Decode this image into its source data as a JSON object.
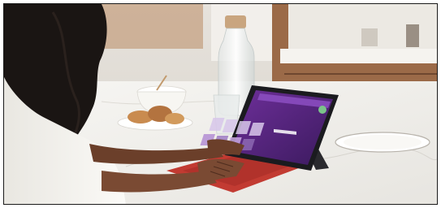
{
  "scene": {
    "description_icon": "photo-of-person-typing-on-tablet",
    "palette": {
      "wall": "#ece9e4",
      "cabinet_wood": "#8a5a3b",
      "counter_marble": "#f2f1ee",
      "keyboard_red": "#c23b32",
      "tablet_frame": "#1b1b1f",
      "screen_purple": "#5b2a86",
      "shirt_white": "#f6f5f1",
      "skin": "#6b3f2a",
      "hair": "#1a1513"
    }
  }
}
